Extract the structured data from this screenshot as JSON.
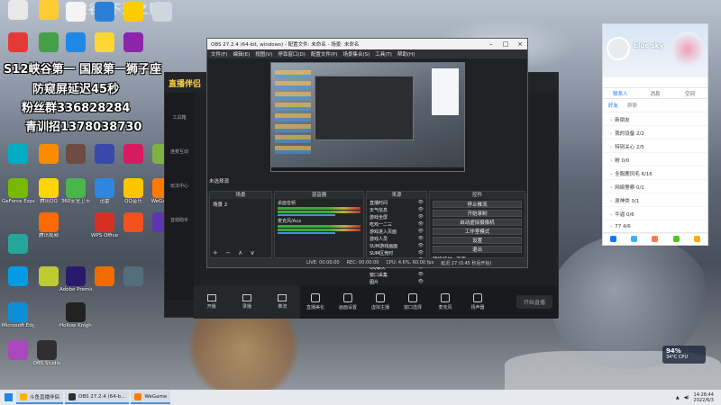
{
  "overlay": {
    "line1": "S12峡谷第一 国服第一狮子座",
    "line2": "防窥屏延迟45秒",
    "line3": "粉丝群336828284",
    "line4": "青训招1378038730",
    "watermark": "峡谷(不逝之影)"
  },
  "desktop_icons": [
    {
      "label": "",
      "color": "#e8e8e8"
    },
    {
      "label": "",
      "color": "#ffcc33"
    },
    {
      "label": "",
      "color": "#f4f4f4"
    },
    {
      "label": "",
      "color": "#2b7fd8"
    },
    {
      "label": "",
      "color": "#ffcc00"
    },
    {
      "label": "",
      "color": "#cfd6de"
    },
    {
      "label": "GeForce Experience",
      "color": "#76b900"
    },
    {
      "label": "腾讯QQ",
      "color": "#ffd400"
    },
    {
      "label": "360安全卫士",
      "color": "#49b649"
    },
    {
      "label": "迅雷",
      "color": "#2e86de"
    },
    {
      "label": "QQ音乐",
      "color": "#ffc400"
    },
    {
      "label": "WeGame",
      "color": "#ff7a00"
    },
    {
      "label": "腾讯视频",
      "color": "#ff6a00"
    },
    {
      "label": "WPS Office",
      "color": "#d93025"
    },
    {
      "label": "Adobe Premiere",
      "color": "#2a1a6e"
    },
    {
      "label": "Microsoft Edge",
      "color": "#0c8fd6"
    },
    {
      "label": "Hollow Knight",
      "color": "#222"
    },
    {
      "label": "OBS Studio",
      "color": "#302e31"
    }
  ],
  "live_app": {
    "logo": "直播伴侣",
    "side_items": [
      "工具箱",
      "连麦互动",
      "玩法中心",
      "音效助手"
    ],
    "bottom_left": [
      "开播",
      "录播",
      "推流"
    ],
    "bottom_tools": [
      "直播美化",
      "画面设置",
      "虚拟主播",
      "窗口选择",
      "麦克风",
      "扬声器"
    ],
    "start_button": "开始直播"
  },
  "obs": {
    "title": "OBS 27.2.4 (64-bit, windows) - 配置文件: 未命名 - 场景: 未命名",
    "menu": [
      "文件(F)",
      "编辑(E)",
      "视图(V)",
      "停靠窗口(D)",
      "配置文件(P)",
      "场景集合(S)",
      "工具(T)",
      "帮助(H)"
    ],
    "no_source": "未选择源",
    "preview_controls": [
      "属性",
      "滤镜"
    ],
    "docks": {
      "scenes_header": "场景",
      "scenes": [
        "场景 2"
      ],
      "mixer_header": "混音器",
      "mixer": [
        "桌面音频",
        "麦克风/Aux"
      ],
      "sources_header": "来源",
      "sources": [
        "直播时间",
        "天气信息",
        "游戏全屏",
        "吃鸡一二三",
        "游戏进入页面",
        "游戏人员",
        "SUM游戏画面",
        "SUM区竞时",
        "直播标签",
        "QQ聊天",
        "窗口采集",
        "图片"
      ],
      "controls_header": "控件",
      "controls": [
        "停止推流",
        "开始录制",
        "启动虚拟摄像机",
        "工作室模式",
        "设置",
        "退出"
      ],
      "transition_label": "转场特效",
      "transition_value": "渐变"
    },
    "status": [
      "LIVE: 00:00:00",
      "REC: 00:00:00",
      "CPU: 4.6%, 60.00 fps",
      "延迟 27 (0.45 秒后开始)"
    ]
  },
  "qq": {
    "nickname": "blue sky",
    "tabs": [
      "联系人",
      "消息",
      "空间"
    ],
    "subtabs": [
      "好友",
      "群聊"
    ],
    "groups": [
      "新朋友",
      "我的设备 2/2",
      "特别关心 2/5",
      "粉 0/0",
      "全服鹿凤毛 6/16",
      "网络警察 0/1",
      "原神类 0/1",
      "牛逼 0/6",
      "77 4/6"
    ]
  },
  "taskbar": {
    "items": [
      {
        "label": "斗鱼直播伴侣",
        "color": "#ffb300"
      },
      {
        "label": "OBS 27.2.4 (64-b...",
        "color": "#302e31"
      },
      {
        "label": "WeGame",
        "color": "#ff7a00"
      }
    ],
    "time": "14:28:44",
    "date": "2022/6/3"
  },
  "perf": {
    "value": "94%",
    "temp": "34°C CPU"
  }
}
